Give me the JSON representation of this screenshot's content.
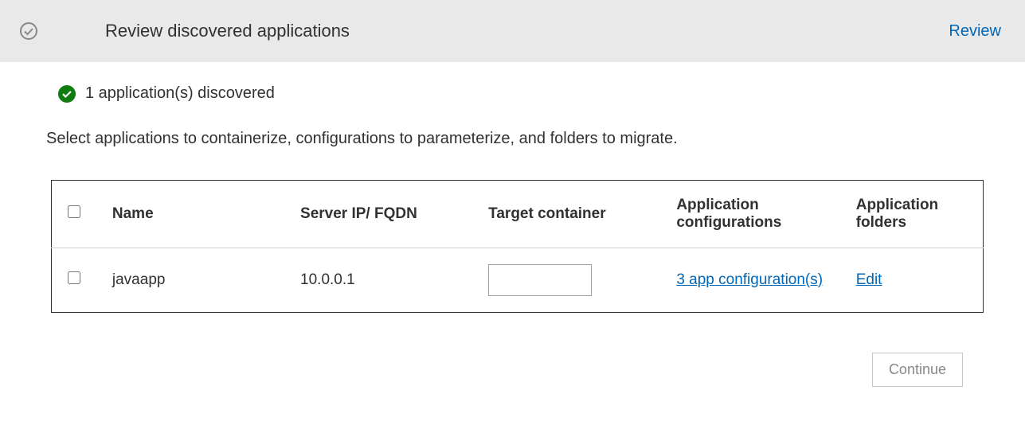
{
  "header": {
    "title": "Review discovered applications",
    "review_link": "Review"
  },
  "status": {
    "text": "1 application(s) discovered"
  },
  "instruction": "Select applications to containerize, configurations to parameterize, and folders to migrate.",
  "table": {
    "headers": {
      "name": "Name",
      "server": "Server IP/ FQDN",
      "target": "Target container",
      "appconfig": "Application configurations",
      "folders": "Application folders"
    },
    "rows": [
      {
        "name": "javaapp",
        "server": "10.0.0.1",
        "target": "",
        "appconfig": "3 app configuration(s)",
        "folders": "Edit"
      }
    ]
  },
  "footer": {
    "continue_label": "Continue"
  }
}
